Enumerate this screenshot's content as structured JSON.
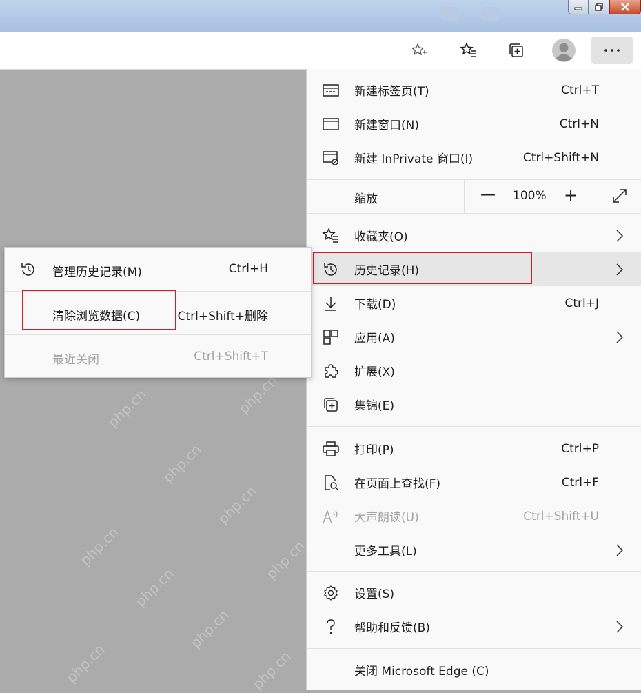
{
  "zoom": {
    "label": "缩放",
    "value": "100%",
    "minus": "—",
    "plus": "+"
  },
  "menu": {
    "items": [
      {
        "id": "new-tab",
        "label": "新建标签页(T)",
        "shortcut": "Ctrl+T",
        "icon": "new-tab-icon"
      },
      {
        "id": "new-window",
        "label": "新建窗口(N)",
        "shortcut": "Ctrl+N",
        "icon": "window-icon"
      },
      {
        "id": "new-inprivate",
        "label": "新建 InPrivate 窗口(I)",
        "shortcut": "Ctrl+Shift+N",
        "icon": "inprivate-icon"
      },
      {
        "id": "favorites",
        "label": "收藏夹(O)",
        "shortcut": "",
        "icon": "favorites-icon",
        "submenu": true
      },
      {
        "id": "history",
        "label": "历史记录(H)",
        "shortcut": "",
        "icon": "history-icon",
        "submenu": true,
        "hover": true
      },
      {
        "id": "downloads",
        "label": "下载(D)",
        "shortcut": "Ctrl+J",
        "icon": "download-icon"
      },
      {
        "id": "apps",
        "label": "应用(A)",
        "shortcut": "",
        "icon": "apps-icon",
        "submenu": true
      },
      {
        "id": "extensions",
        "label": "扩展(X)",
        "shortcut": "",
        "icon": "puzzle-icon"
      },
      {
        "id": "collections",
        "label": "集锦(E)",
        "shortcut": "",
        "icon": "collections-icon"
      },
      {
        "id": "print",
        "label": "打印(P)",
        "shortcut": "Ctrl+P",
        "icon": "printer-icon"
      },
      {
        "id": "find",
        "label": "在页面上查找(F)",
        "shortcut": "Ctrl+F",
        "icon": "find-icon"
      },
      {
        "id": "read-aloud",
        "label": "大声朗读(U)",
        "shortcut": "Ctrl+Shift+U",
        "icon": "read-aloud-icon",
        "disabled": true
      },
      {
        "id": "more-tools",
        "label": "更多工具(L)",
        "shortcut": "",
        "icon": "",
        "submenu": true
      },
      {
        "id": "settings",
        "label": "设置(S)",
        "shortcut": "",
        "icon": "gear-icon"
      },
      {
        "id": "help",
        "label": "帮助和反馈(B)",
        "shortcut": "",
        "icon": "help-icon",
        "submenu": true
      },
      {
        "id": "close-edge",
        "label": "关闭 Microsoft Edge (C)",
        "shortcut": "",
        "icon": ""
      }
    ]
  },
  "history_submenu": {
    "items": [
      {
        "id": "manage-history",
        "label": "管理历史记录(M)",
        "shortcut": "Ctrl+H",
        "icon": "history-icon"
      },
      {
        "id": "clear-data",
        "label": "清除浏览数据(C)",
        "shortcut": "Ctrl+Shift+删除",
        "highlighted": true
      },
      {
        "id": "recently-closed",
        "label": "最近关闭",
        "shortcut": "Ctrl+Shift+T",
        "disabled": true
      }
    ]
  },
  "watermark": "php.cn",
  "colors": {
    "highlight": "#d01f28",
    "menu_bg": "#f9f9f9",
    "hover_bg": "#e6e6e6"
  }
}
